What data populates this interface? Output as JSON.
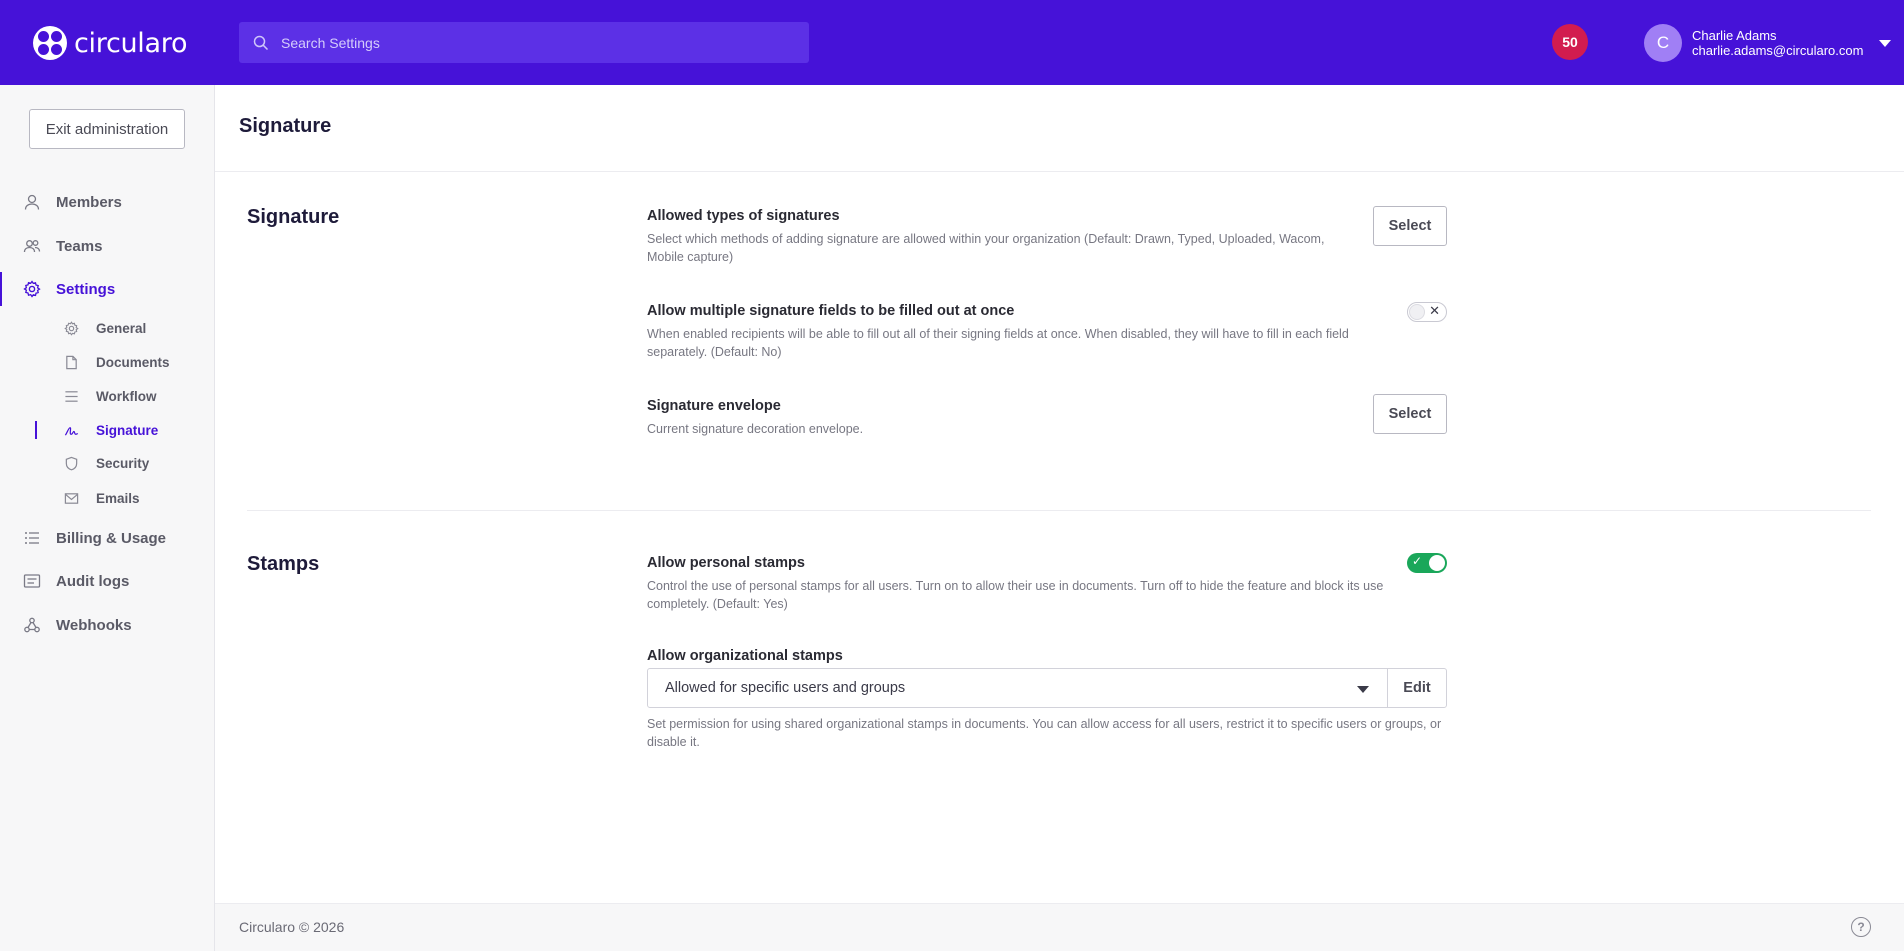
{
  "header": {
    "logo_text": "circularo",
    "search_placeholder": "Search Settings",
    "notification_count": "50",
    "user": {
      "initial": "C",
      "name": "Charlie Adams",
      "email": "charlie.adams@circularo.com"
    }
  },
  "sidebar": {
    "exit_label": "Exit administration",
    "items": [
      {
        "label": "Members",
        "icon": "user-icon"
      },
      {
        "label": "Teams",
        "icon": "team-icon"
      },
      {
        "label": "Settings",
        "icon": "gear-icon",
        "active": true
      },
      {
        "label": "Billing & Usage",
        "icon": "list-icon"
      },
      {
        "label": "Audit logs",
        "icon": "log-icon"
      },
      {
        "label": "Webhooks",
        "icon": "webhook-icon"
      }
    ],
    "sub_items": [
      {
        "label": "General",
        "icon": "gear-icon"
      },
      {
        "label": "Documents",
        "icon": "document-icon"
      },
      {
        "label": "Workflow",
        "icon": "workflow-icon"
      },
      {
        "label": "Signature",
        "icon": "signature-icon",
        "active": true
      },
      {
        "label": "Security",
        "icon": "shield-icon"
      },
      {
        "label": "Emails",
        "icon": "mail-icon"
      }
    ]
  },
  "main": {
    "page_title": "Signature",
    "signature_section": {
      "title": "Signature",
      "allowed_types": {
        "title": "Allowed types of signatures",
        "desc": "Select which methods of adding signature are allowed within your organization  (Default: Drawn, Typed, Uploaded, Wacom, Mobile capture)",
        "button": "Select"
      },
      "multiple_fields": {
        "title": "Allow multiple signature fields to be filled out at once",
        "desc": "When enabled recipients will be able to fill out all of their signing fields at once. When disabled, they will have to fill in each field separately.  (Default: No)",
        "enabled": false,
        "mark": "✕"
      },
      "envelope": {
        "title": "Signature envelope",
        "desc": "Current signature decoration envelope.",
        "button": "Select"
      }
    },
    "stamps_section": {
      "title": "Stamps",
      "personal": {
        "title": "Allow personal stamps",
        "desc": "Control the use of personal stamps for all users. Turn on to allow their use in documents. Turn off to hide the feature and block its use completely.  (Default: Yes)",
        "enabled": true,
        "mark": "✓"
      },
      "organizational": {
        "title": "Allow organizational stamps",
        "selected": "Allowed for specific users and groups",
        "edit_label": "Edit",
        "desc": "Set permission for using shared organizational stamps in documents. You can allow access for all users, restrict it to specific users or groups, or disable it."
      }
    }
  },
  "footer": {
    "copyright": "Circularo © 2026",
    "help_glyph": "?"
  },
  "colors": {
    "brand": "#4612d8",
    "notification": "#d21c4f",
    "toggle_on": "#1aa75a"
  }
}
